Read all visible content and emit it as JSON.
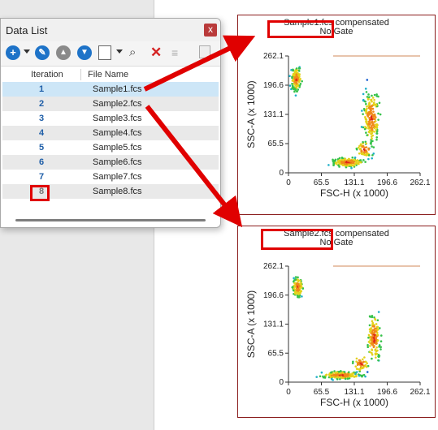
{
  "data_list": {
    "title": "Data List",
    "close_glyph": "x",
    "columns": {
      "iteration": "Iteration",
      "file_name": "File Name"
    },
    "rows": [
      {
        "iteration": "1",
        "file": "Sample1.fcs"
      },
      {
        "iteration": "2",
        "file": "Sample2.fcs"
      },
      {
        "iteration": "3",
        "file": "Sample3.fcs"
      },
      {
        "iteration": "4",
        "file": "Sample4.fcs"
      },
      {
        "iteration": "5",
        "file": "Sample5.fcs"
      },
      {
        "iteration": "6",
        "file": "Sample6.fcs"
      },
      {
        "iteration": "7",
        "file": "Sample7.fcs"
      },
      {
        "iteration": "8",
        "file": "Sample8.fcs"
      }
    ],
    "toolbar_icons": [
      "add-icon",
      "wrench-icon",
      "up-icon",
      "down-icon",
      "layout-icon",
      "search-icon",
      "delete-icon",
      "list-icon",
      "export-icon"
    ]
  },
  "plots": [
    {
      "title_prefix": "Sample1.fcs",
      "title_suffix": "compensated",
      "gate": "No Gate",
      "xlabel": "FSC-H (x 1000)",
      "ylabel": "SSC-A (x 1000)",
      "xticks": [
        "0",
        "65.5",
        "131.1",
        "196.6",
        "262.1"
      ],
      "yticks": [
        "0",
        "65.5",
        "131.1",
        "196.6",
        "262.1"
      ]
    },
    {
      "title_prefix": "Sample2.fcs",
      "title_suffix": "compensated",
      "gate": "No Gate",
      "xlabel": "FSC-H (x 1000)",
      "ylabel": "SSC-A (x 1000)",
      "xticks": [
        "0",
        "65.5",
        "131.1",
        "196.6",
        "262.1"
      ],
      "yticks": [
        "0",
        "65.5",
        "131.1",
        "196.6",
        "262.1"
      ]
    }
  ],
  "colors": {
    "highlight": "#e00000",
    "selected_row": "#cde6f7",
    "iteration_text": "#1f5fa8"
  }
}
